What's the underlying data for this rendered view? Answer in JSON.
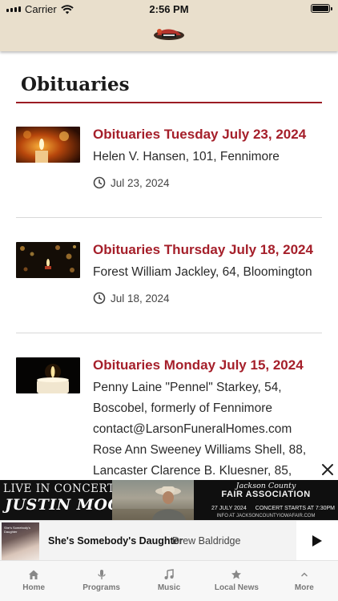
{
  "status_bar": {
    "carrier": "Carrier",
    "time": "2:56 PM",
    "battery_level": 1.0
  },
  "header": {
    "logo_icon": "station-logo-icon"
  },
  "page": {
    "title": "Obituaries"
  },
  "articles": [
    {
      "title": "Obituaries Tuesday July 23, 2024",
      "summary_lines": [
        "Helen V. Hansen, 101, Fennimore"
      ],
      "date": "Jul 23, 2024",
      "thumbnail_icon": "candles-thumbnail"
    },
    {
      "title": "Obituaries Thursday July 18, 2024",
      "summary_lines": [
        "Forest William Jackley, 64, Bloomington"
      ],
      "date": "Jul 18, 2024",
      "thumbnail_icon": "candle-bokeh-thumbnail"
    },
    {
      "title": "Obituaries Monday July 15, 2024",
      "summary_lines": [
        "Penny Laine \"Pennel\" Starkey, 54,",
        "Boscobel, formerly of Fennimore",
        "contact@LarsonFuneralHomes.com",
        "Rose Ann Sweeney Williams Shell, 88,",
        "Lancaster Clarence B. Kluesner, 85,"
      ],
      "date": "",
      "thumbnail_icon": "single-candle-thumbnail"
    }
  ],
  "ad": {
    "live_text": "LIVE IN CONCERT",
    "artist_text": "JUSTIN MOORE",
    "county_text": "Jackson County",
    "fair_text": "FAIR ASSOCIATION",
    "date_text": "27 JULY 2024",
    "concert_text": "CONCERT STARTS AT 7:30PM",
    "info_text": "INFO AT JACKSONCOUNTYIOWAFAIR.COM",
    "close_icon": "close-icon"
  },
  "player": {
    "album_text": "She's Somebody's Daughter",
    "song": "She's Somebody's Daughter",
    "artist": "Drew Baldridge",
    "play_icon": "play-icon"
  },
  "tabs": [
    {
      "label": "Home",
      "icon": "home-icon"
    },
    {
      "label": "Programs",
      "icon": "microphone-icon"
    },
    {
      "label": "Music",
      "icon": "music-note-icon"
    },
    {
      "label": "Local News",
      "icon": "star-icon"
    },
    {
      "label": "More",
      "icon": "chevron-up-icon"
    }
  ],
  "colors": {
    "accent": "#a51f2a",
    "header_bg": "#e9dfcc",
    "rule": "#9b1c24"
  }
}
